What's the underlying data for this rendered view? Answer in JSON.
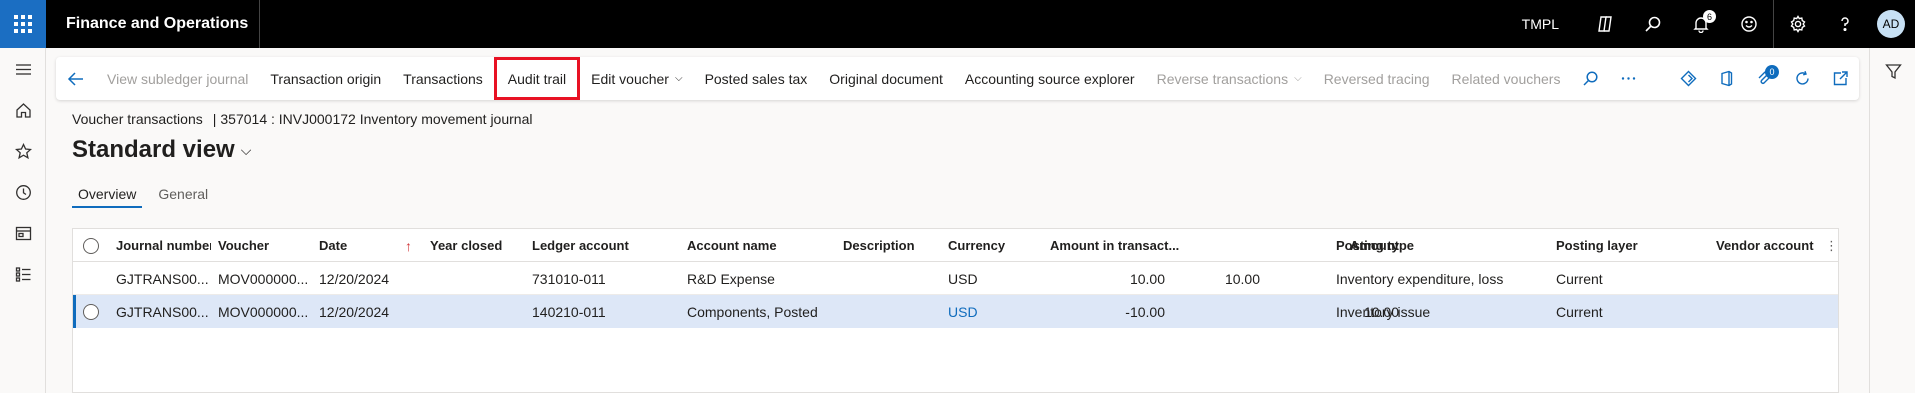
{
  "app": {
    "title": "Finance and Operations",
    "company": "TMPL",
    "notifications_count": "6",
    "user_initials": "AD"
  },
  "action_pane": {
    "items": [
      {
        "label": "View subledger journal",
        "disabled": true
      },
      {
        "label": "Transaction origin",
        "disabled": false
      },
      {
        "label": "Transactions",
        "disabled": false
      },
      {
        "label": "Audit trail",
        "disabled": false,
        "highlighted": true
      },
      {
        "label": "Edit voucher",
        "disabled": false,
        "dropdown": true
      },
      {
        "label": "Posted sales tax",
        "disabled": false
      },
      {
        "label": "Original document",
        "disabled": false
      },
      {
        "label": "Accounting source explorer",
        "disabled": false
      },
      {
        "label": "Reverse transactions",
        "disabled": true,
        "dropdown": true
      },
      {
        "label": "Reversed tracing",
        "disabled": true
      },
      {
        "label": "Related vouchers",
        "disabled": true
      }
    ],
    "attachments_count": "0"
  },
  "header": {
    "breadcrumb_page": "Voucher transactions",
    "breadcrumb_separator": "|",
    "breadcrumb_record": "357014 : INVJ000172 Inventory movement journal",
    "view_name": "Standard view"
  },
  "tabs": [
    {
      "label": "Overview",
      "active": true
    },
    {
      "label": "General",
      "active": false
    }
  ],
  "grid": {
    "columns": [
      "Journal number",
      "Voucher",
      "Date",
      "Year closed",
      "Ledger account",
      "Account name",
      "Description",
      "Currency",
      "Amount in transact...",
      "Amount",
      "Posting type",
      "Posting layer",
      "Vendor account"
    ],
    "rows": [
      {
        "journal": "GJTRANS00...",
        "voucher": "MOV000000...",
        "date": "12/20/2024",
        "year_closed": "",
        "ledger": "731010-011",
        "account_name": "R&D Expense",
        "description": "",
        "currency": "USD",
        "amount_trans": "10.00",
        "amount_extra": "10.00",
        "amount": "",
        "posting_type": "Inventory expenditure, loss",
        "posting_layer": "Current",
        "vendor": "",
        "selected": false
      },
      {
        "journal": "GJTRANS00...",
        "voucher": "MOV000000...",
        "date": "12/20/2024",
        "year_closed": "",
        "ledger": "140210-011",
        "account_name": "Components, Posted",
        "description": "",
        "currency": "USD",
        "amount_trans": "-10.00",
        "amount_extra": "",
        "amount": "10.00",
        "posting_type": "Inventory issue",
        "posting_layer": "Current",
        "vendor": "",
        "selected": true
      }
    ]
  },
  "colors": {
    "accent": "#0f6cbd",
    "highlight_box": "#e81123",
    "selected_row": "#dde7f7",
    "top_bar": "#000000"
  }
}
